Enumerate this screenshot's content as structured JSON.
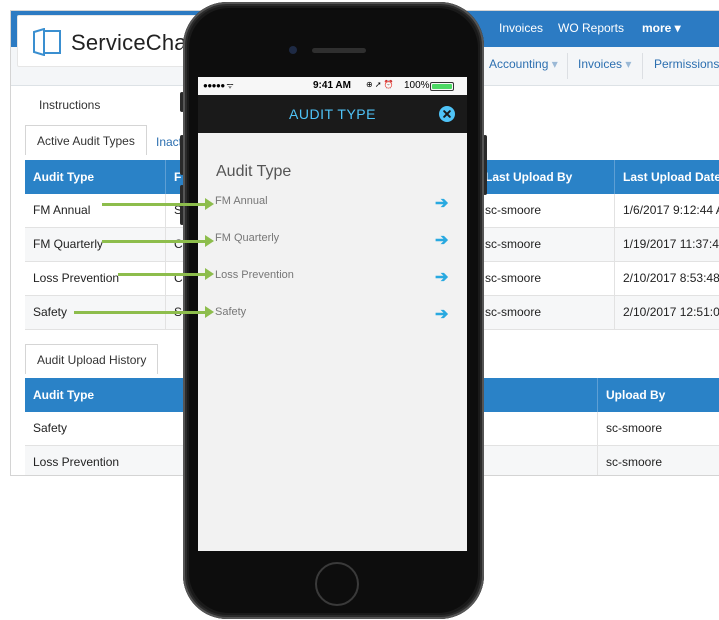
{
  "web_app": {
    "logo_text": "ServiceChan",
    "top_nav": [
      "Invoices",
      "WO Reports",
      "more ▾"
    ],
    "sub_nav": [
      "Accounting",
      "Invoices",
      "Permissions"
    ],
    "instructions_link": "Instructions",
    "tabs": {
      "active": "Active Audit Types",
      "inactive_partial": "Inact"
    },
    "audit_types_table": {
      "headers": [
        "Audit Type",
        "F",
        "Last Upload By",
        "Last Upload Date"
      ],
      "rows": [
        {
          "audit_type": "FM Annual",
          "f": "S",
          "last_upload_by": "sc-smoore",
          "last_upload_date": "1/6/2017 9:12:44 A"
        },
        {
          "audit_type": "FM Quarterly",
          "f": "C",
          "last_upload_by": "sc-smoore",
          "last_upload_date": "1/19/2017 11:37:4"
        },
        {
          "audit_type": "Loss Prevention",
          "f": "C",
          "last_upload_by": "sc-smoore",
          "last_upload_date": "2/10/2017 8:53:48"
        },
        {
          "audit_type": "Safety",
          "f": "S",
          "last_upload_by": "sc-smoore",
          "last_upload_date": "2/10/2017 12:51:0"
        }
      ]
    },
    "history_tab": "Audit Upload History",
    "history_table": {
      "headers": [
        "Audit Type",
        "Upload By"
      ],
      "rows": [
        {
          "audit_type": "Safety",
          "upload_by": "sc-smoore"
        },
        {
          "audit_type": "Loss Prevention",
          "upload_by": "sc-smoore"
        }
      ]
    }
  },
  "phone": {
    "status": {
      "signal": "●●●●● ᯤ",
      "time": "9:41 AM",
      "icons": "⊕ ➚ ⏰",
      "battery": "100%"
    },
    "header_title": "AUDIT TYPE",
    "section_title": "Audit Type",
    "items": [
      {
        "label": "FM Annual"
      },
      {
        "label": "FM Quarterly"
      },
      {
        "label": "Loss Prevention"
      },
      {
        "label": "Safety"
      }
    ]
  },
  "colors": {
    "brand_blue": "#2a82c7",
    "accent_cyan": "#29a9e0",
    "callout_green": "#8dbd4c"
  }
}
